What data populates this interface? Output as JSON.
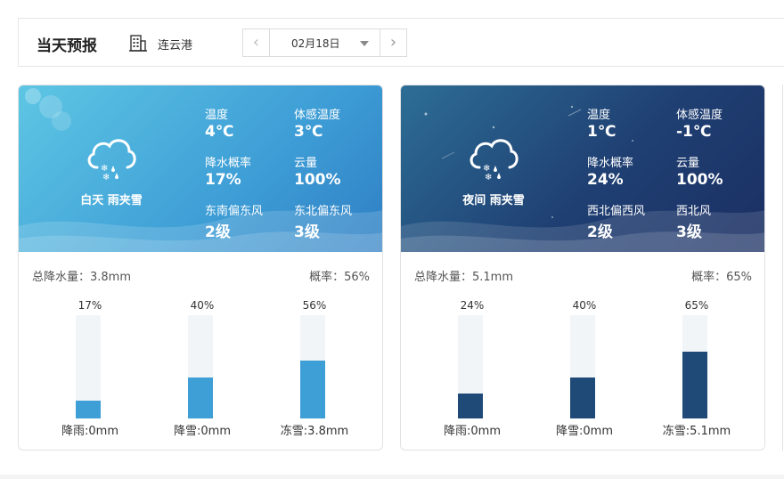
{
  "header": {
    "title": "当天预报",
    "city": "连云港",
    "date": "02月18日",
    "prev_icon": "chevron-left-icon",
    "next_icon": "chevron-right-icon"
  },
  "colors": {
    "day_fill": "#3e9ed6",
    "night_fill": "#1f4a78",
    "track": "#f2f5f8"
  },
  "day": {
    "period": "白天 雨夹雪",
    "icon": "sleet-cloud-icon",
    "metrics": {
      "temp_label": "温度",
      "temp_value": "4℃",
      "feels_label": "体感温度",
      "feels_value": "3℃",
      "precip_prob_label": "降水概率",
      "precip_prob_value": "17%",
      "cloud_label": "云量",
      "cloud_value": "100%",
      "wind1_label": "东南偏东风",
      "wind1_value": "2级",
      "wind2_label": "东北偏东风",
      "wind2_value": "3级"
    },
    "total_precip": "总降水量：3.8mm",
    "probability": "概率：56%",
    "bars": [
      {
        "pct_label": "17%",
        "value": 17,
        "caption": "降雨:0mm"
      },
      {
        "pct_label": "40%",
        "value": 40,
        "caption": "降雪:0mm"
      },
      {
        "pct_label": "56%",
        "value": 56,
        "caption": "冻雪:3.8mm"
      }
    ]
  },
  "night": {
    "period": "夜间 雨夹雪",
    "icon": "sleet-cloud-icon",
    "metrics": {
      "temp_label": "温度",
      "temp_value": "1℃",
      "feels_label": "体感温度",
      "feels_value": "-1℃",
      "precip_prob_label": "降水概率",
      "precip_prob_value": "24%",
      "cloud_label": "云量",
      "cloud_value": "100%",
      "wind1_label": "西北偏西风",
      "wind1_value": "2级",
      "wind2_label": "西北风",
      "wind2_value": "3级"
    },
    "total_precip": "总降水量：5.1mm",
    "probability": "概率：65%",
    "bars": [
      {
        "pct_label": "24%",
        "value": 24,
        "caption": "降雨:0mm"
      },
      {
        "pct_label": "40%",
        "value": 40,
        "caption": "降雪:0mm"
      },
      {
        "pct_label": "65%",
        "value": 65,
        "caption": "冻雪:5.1mm"
      }
    ]
  }
}
